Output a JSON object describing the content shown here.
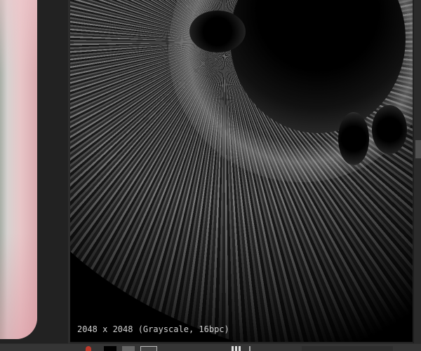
{
  "viewer": {
    "image_info": "2048 x 2048 (Grayscale, 16bpc)"
  },
  "icons": [
    "record-icon",
    "color-swatch-icon",
    "grid-icon",
    "display-icon",
    "channels-icon",
    "histogram-icon"
  ]
}
